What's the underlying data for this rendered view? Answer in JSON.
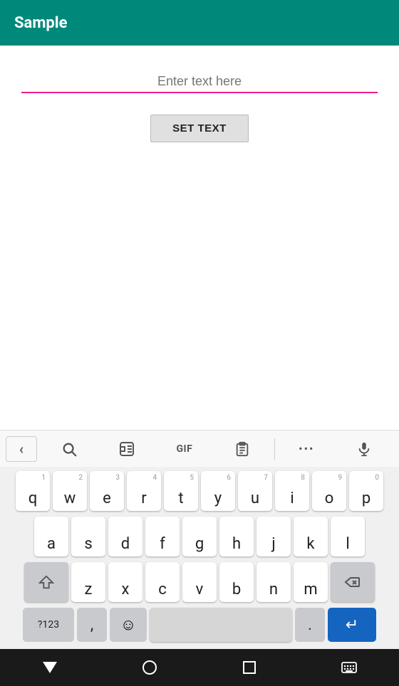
{
  "appBar": {
    "title": "Sample",
    "backgroundColor": "#00897B"
  },
  "content": {
    "inputPlaceholder": "Enter text here",
    "inputValue": "",
    "setTextButton": "SET TEXT",
    "underlineColor": "#E91E8C"
  },
  "toolbar": {
    "backLabel": "‹",
    "searchLabel": "🔍",
    "stickerLabel": "🖼",
    "gifLabel": "GIF",
    "clipboardLabel": "📋",
    "moreLabel": "•••",
    "micLabel": "🎤"
  },
  "keyboard": {
    "row1": [
      {
        "char": "q",
        "num": "1"
      },
      {
        "char": "w",
        "num": "2"
      },
      {
        "char": "e",
        "num": "3"
      },
      {
        "char": "r",
        "num": "4"
      },
      {
        "char": "t",
        "num": "5"
      },
      {
        "char": "y",
        "num": "6"
      },
      {
        "char": "u",
        "num": "7"
      },
      {
        "char": "i",
        "num": "8"
      },
      {
        "char": "o",
        "num": "9"
      },
      {
        "char": "p",
        "num": "0"
      }
    ],
    "row2": [
      {
        "char": "a"
      },
      {
        "char": "s"
      },
      {
        "char": "d"
      },
      {
        "char": "f"
      },
      {
        "char": "g"
      },
      {
        "char": "h"
      },
      {
        "char": "j"
      },
      {
        "char": "k"
      },
      {
        "char": "l"
      }
    ],
    "row3": [
      {
        "char": "z"
      },
      {
        "char": "x"
      },
      {
        "char": "c"
      },
      {
        "char": "v"
      },
      {
        "char": "b"
      },
      {
        "char": "n"
      },
      {
        "char": "m"
      }
    ],
    "bottomRow": {
      "numbers": "?123",
      "comma": ",",
      "period": ".",
      "enterIcon": "↵"
    }
  },
  "navBar": {
    "items": [
      "triangle",
      "circle",
      "square",
      "keyboard"
    ]
  }
}
